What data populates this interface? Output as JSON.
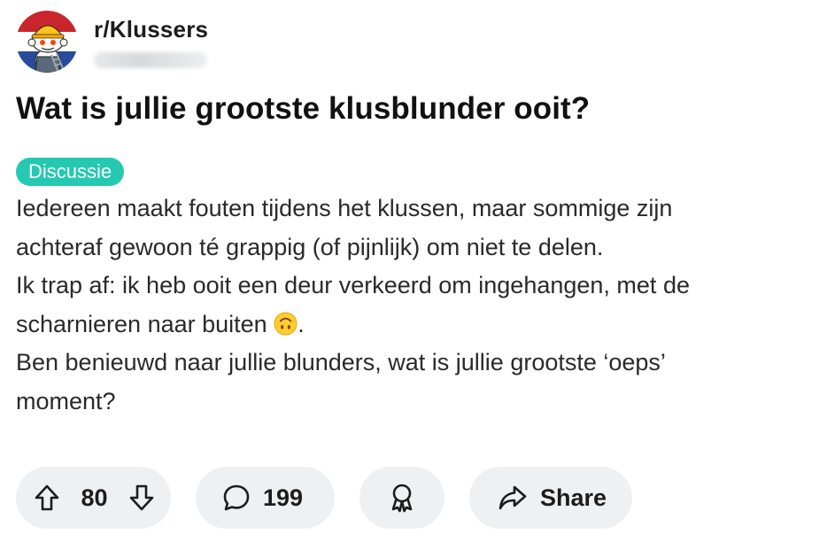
{
  "post": {
    "subreddit": "r/Klussers",
    "title": "Wat is jullie grootste klusblunder ooit?",
    "flair": "Discussie",
    "flair_color": "#25c9b2",
    "body": {
      "line1": "Iedereen maakt fouten tijdens het klussen, maar sommige zijn",
      "line2": "achteraf gewoon té grappig (of pijnlijk) om niet te delen.",
      "line3": "Ik trap af: ik heb ooit een deur verkeerd om ingehangen, met de",
      "line4_before_emoji": "scharnieren naar buiten ",
      "line4_after_emoji": ".",
      "emoji": "upside-down-face-emoji",
      "line5": "Ben benieuwd naar jullie blunders, wat is jullie grootste ‘oeps’",
      "line6": "moment?"
    }
  },
  "actions": {
    "upvote_icon": "arrow-up-icon",
    "votes": "80",
    "downvote_icon": "arrow-down-icon",
    "comment_icon": "speech-bubble-icon",
    "comments": "199",
    "award_icon": "award-ribbon-icon",
    "share_icon": "share-arrow-icon",
    "share_label": "Share"
  }
}
